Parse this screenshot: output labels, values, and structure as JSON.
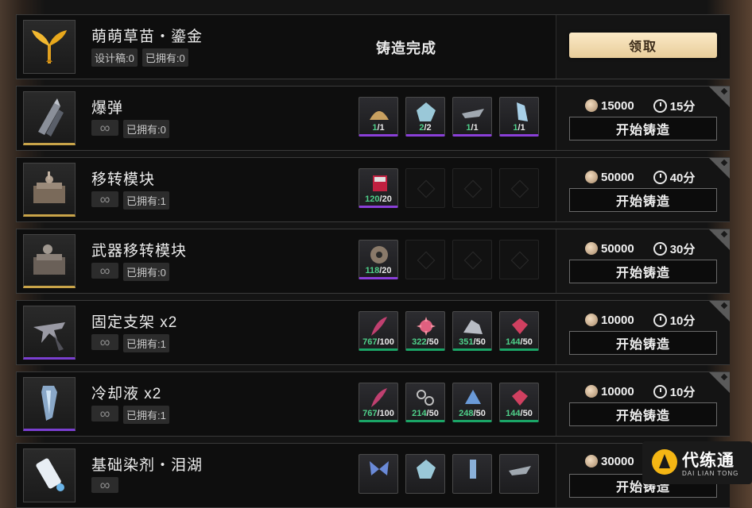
{
  "top_item": {
    "name": "萌萌草苗・鎏金",
    "badges": [
      "设计稿:0",
      "已拥有:0"
    ],
    "status": "铸造完成",
    "action_label": "领取",
    "icon": "golden-sprout-icon"
  },
  "items": [
    {
      "name": "爆弹",
      "owned": "已拥有:0",
      "icon": "bomb-shell-icon",
      "rarity": "gold",
      "materials": [
        {
          "have": "1",
          "req": "/1",
          "bar": "purple",
          "icon": "sand-pile-icon"
        },
        {
          "have": "2",
          "req": "/2",
          "bar": "purple",
          "icon": "crystal-icon"
        },
        {
          "have": "1",
          "req": "/1",
          "bar": "purple",
          "icon": "metal-shard-icon"
        },
        {
          "have": "1",
          "req": "/1",
          "bar": "purple",
          "icon": "ice-shard-icon"
        }
      ],
      "cost": "15000",
      "time": "15分",
      "button": "开始铸造"
    },
    {
      "name": "移转模块",
      "owned": "已拥有:1",
      "icon": "transfer-module-icon",
      "rarity": "gold",
      "materials": [
        {
          "have": "120",
          "req": "/20",
          "bar": "purple",
          "icon": "red-cube-icon"
        },
        {
          "empty": true
        },
        {
          "empty": true
        },
        {
          "empty": true
        }
      ],
      "cost": "50000",
      "time": "40分",
      "button": "开始铸造"
    },
    {
      "name": "武器移转模块",
      "owned": "已拥有:0",
      "icon": "weapon-transfer-module-icon",
      "rarity": "gold",
      "materials": [
        {
          "have": "118",
          "req": "/20",
          "bar": "purple",
          "icon": "sphere-core-icon"
        },
        {
          "empty": true
        },
        {
          "empty": true
        },
        {
          "empty": true
        }
      ],
      "cost": "50000",
      "time": "30分",
      "button": "开始铸造"
    },
    {
      "name": "固定支架 x2",
      "owned": "已拥有:1",
      "icon": "fixed-bracket-icon",
      "rarity": "purple",
      "materials": [
        {
          "have": "767",
          "req": "/100",
          "bar": "green",
          "icon": "feather-icon"
        },
        {
          "have": "322",
          "req": "/50",
          "bar": "green",
          "icon": "spiky-orb-icon"
        },
        {
          "have": "351",
          "req": "/50",
          "bar": "green",
          "icon": "scrap-metal-icon"
        },
        {
          "have": "144",
          "req": "/50",
          "bar": "green",
          "icon": "pink-gem-icon"
        }
      ],
      "cost": "10000",
      "time": "10分",
      "button": "开始铸造"
    },
    {
      "name": "冷却液 x2",
      "owned": "已拥有:1",
      "icon": "coolant-icon",
      "rarity": "purple",
      "materials": [
        {
          "have": "767",
          "req": "/100",
          "bar": "green",
          "icon": "feather-icon"
        },
        {
          "have": "214",
          "req": "/50",
          "bar": "green",
          "icon": "chain-icon"
        },
        {
          "have": "248",
          "req": "/50",
          "bar": "green",
          "icon": "blue-crystal-icon"
        },
        {
          "have": "144",
          "req": "/50",
          "bar": "green",
          "icon": "pink-gem-icon"
        }
      ],
      "cost": "10000",
      "time": "10分",
      "button": "开始铸造"
    },
    {
      "name": "基础染剂・泪湖",
      "owned": "",
      "icon": "dye-tube-icon",
      "rarity": "none",
      "materials": [
        {
          "empty": false,
          "have": "",
          "req": "",
          "bar": "none",
          "icon": "butterfly-icon"
        },
        {
          "empty": false,
          "have": "",
          "req": "",
          "bar": "none",
          "icon": "crystal-icon"
        },
        {
          "empty": false,
          "have": "",
          "req": "",
          "bar": "none",
          "icon": "tube-icon"
        },
        {
          "empty": false,
          "have": "",
          "req": "",
          "bar": "none",
          "icon": "metal-shard-icon"
        }
      ],
      "cost": "30000",
      "time": "",
      "button": "开始铸造"
    }
  ],
  "watermark": {
    "cn": "代练通",
    "en": "DAI LIAN TONG"
  },
  "colors": {
    "gold_rarity": "#c9a449",
    "purple_rarity": "#7a3fd0",
    "material_ok": "#4fd08a",
    "claim_button": "#f4dfb4",
    "watermark_mark": "#f4b614"
  }
}
